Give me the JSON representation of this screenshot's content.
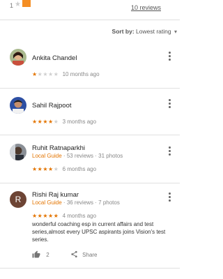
{
  "histogram": {
    "row_label": "1",
    "star": "★",
    "bar_color": "#f48e24",
    "reviews_link": "10 reviews"
  },
  "sort": {
    "prefix": "Sort by:",
    "value": "Lowest rating",
    "chevron": "▾"
  },
  "reviews": [
    {
      "name": "Ankita Chandel",
      "local_guide": "",
      "meta": "",
      "rating": 1,
      "stars_on": "★",
      "stars_off": "★★★★",
      "time": "10 months ago",
      "text": "",
      "likes": "",
      "share": ""
    },
    {
      "name": "Sahil Rajpoot",
      "local_guide": "",
      "meta": "",
      "rating": 4,
      "stars_on": "★★★★",
      "stars_off": "★",
      "time": "3 months ago",
      "text": "",
      "likes": "",
      "share": ""
    },
    {
      "name": "Ruhit Ratnaparkhi",
      "local_guide": "Local Guide",
      "meta": " · 53 reviews · 31 photos",
      "rating": 4,
      "stars_on": "★★★★",
      "stars_off": "★",
      "time": "6 months ago",
      "text": "",
      "likes": "",
      "share": ""
    },
    {
      "name": "Rishi Raj kumar",
      "avatar_letter": "R",
      "local_guide": "Local Guide",
      "meta": " · 36 reviews · 7 photos",
      "rating": 5,
      "stars_on": "★★★★★",
      "stars_off": "",
      "time": "4 months ago",
      "text": "wonderful coaching esp in current affairs and test series,almost every UPSC aspirants joins Vision's test series.",
      "likes": "2",
      "share": "Share"
    }
  ],
  "icons": {
    "more": "more-vert-icon",
    "like": "thumbs-up-icon",
    "share": "share-icon"
  },
  "colors": {
    "accent": "#e37400",
    "bar": "#f48e24",
    "avatar_r": "#6d4434"
  }
}
